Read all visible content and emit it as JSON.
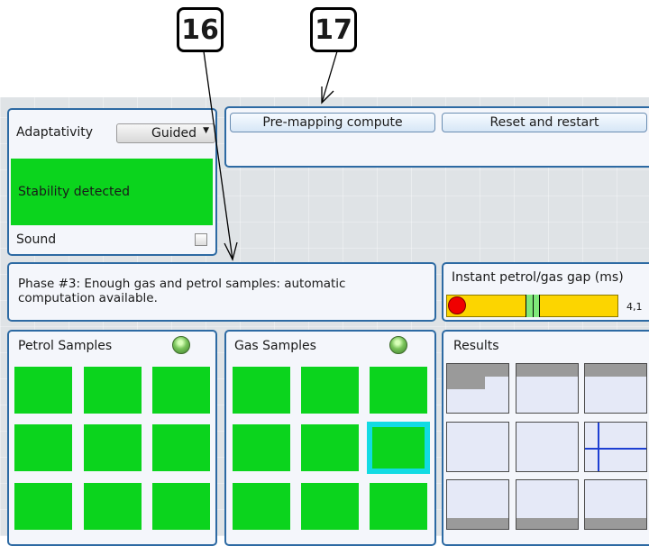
{
  "callouts": [
    "16",
    "17"
  ],
  "controls": {
    "adaptativity_label": "Adaptativity",
    "adaptativity_value": "Guided",
    "status_text": "Stability detected",
    "sound_label": "Sound",
    "sound_checked": false,
    "status_color": "#0bd41d"
  },
  "toolbar": {
    "premapping_label": "Pre-mapping compute",
    "reset_label": "Reset and restart"
  },
  "phase": {
    "line1": "Phase #3: Enough gas and petrol samples: automatic",
    "line2": "computation available."
  },
  "gap": {
    "title": "Instant petrol/gas gap (ms)",
    "value": "4,1",
    "bar_color": "#fcd500"
  },
  "petrol": {
    "title": "Petrol Samples",
    "tile_color": "#0bd41d"
  },
  "gas": {
    "title": "Gas Samples",
    "selected_tile_border": "#12dbe3"
  },
  "results": {
    "title": "Results",
    "line_color": "#1d3fd2"
  }
}
